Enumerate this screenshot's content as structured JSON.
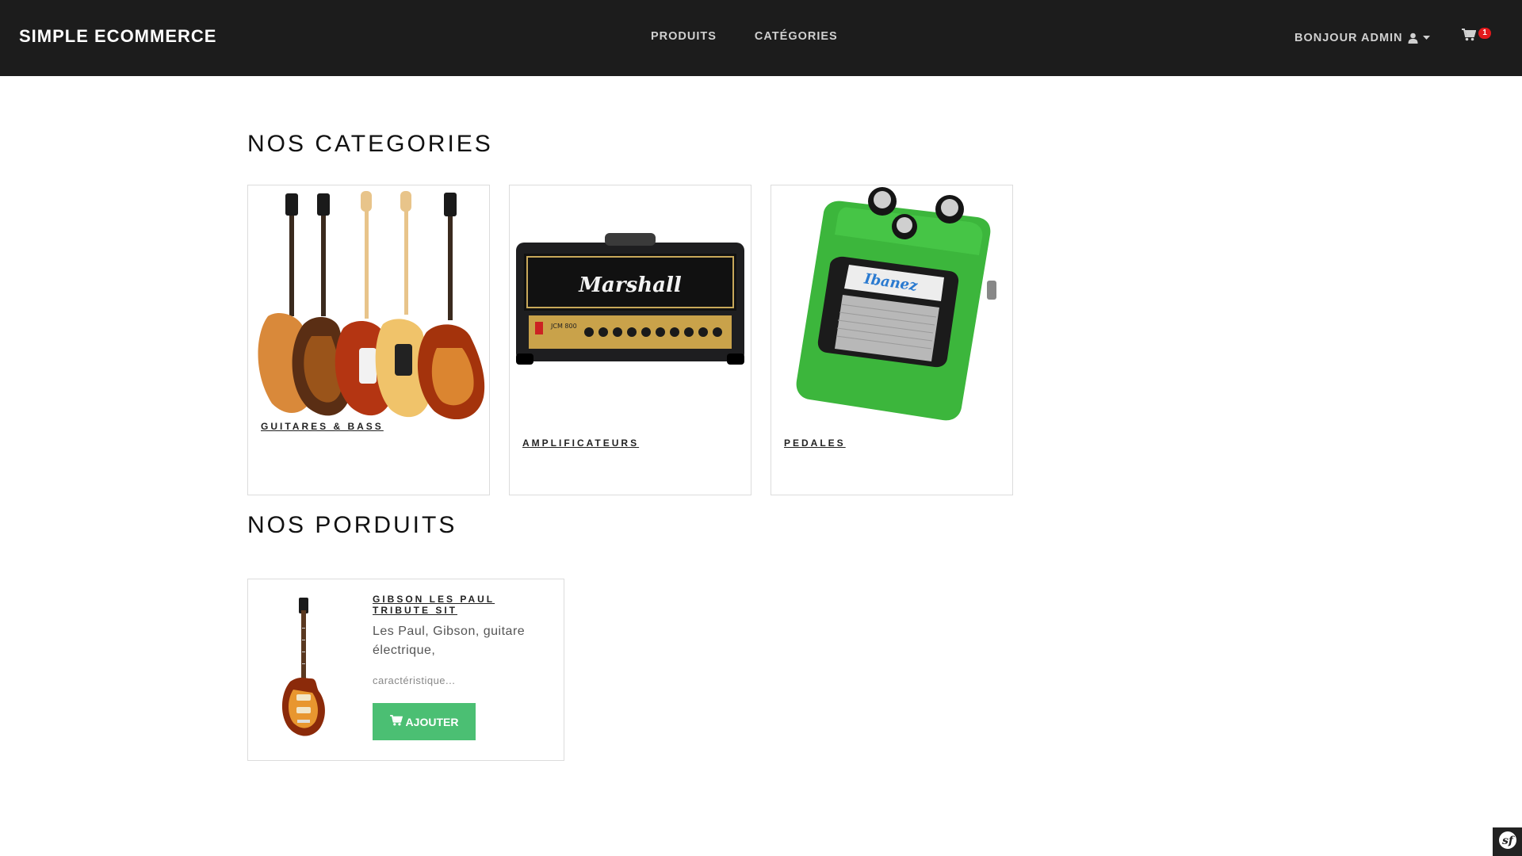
{
  "navbar": {
    "brand": "SIMPLE ECOMMERCE",
    "links": [
      {
        "label": "PRODUITS"
      },
      {
        "label": "CATÉGORIES"
      }
    ],
    "user_label": "BONJOUR ADMIN",
    "cart_count": "1"
  },
  "categories_section": {
    "title": "NOS CATEGORIES",
    "items": [
      {
        "label": "GUITARES & BASS",
        "image": "guitars-image"
      },
      {
        "label": "AMPLIFICATEURS",
        "image": "marshall-amp-image"
      },
      {
        "label": "PEDALES",
        "image": "ibanez-pedal-image"
      }
    ]
  },
  "products_section": {
    "title": "NOS PORDUITS",
    "items": [
      {
        "name": "GIBSON LES PAUL TRIBUTE SIT",
        "description": "Les Paul, Gibson, guitare électrique,",
        "more": "caractéristique...",
        "button_label": "AJOUTER"
      }
    ]
  },
  "pedal_brand": "Ibanez",
  "amp_brand": "Marshall",
  "amp_model": "JCM 800",
  "colors": {
    "navbar_bg": "#1c1c1c",
    "button_green": "#4bbf73",
    "badge_red": "#e3191c"
  }
}
